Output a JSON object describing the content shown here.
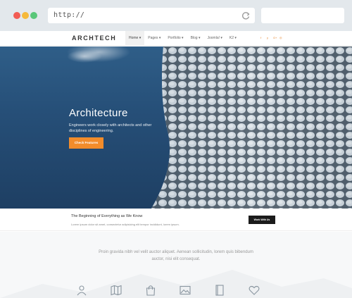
{
  "browser": {
    "url": "http://",
    "icons": {
      "reload": "reload-icon"
    },
    "colors": {
      "close": "#f25c54",
      "minimize": "#f6b93b",
      "maximize": "#59c779"
    }
  },
  "site": {
    "logo": "ARCHTECH",
    "menu": [
      {
        "label": "Home ▾"
      },
      {
        "label": "Pages ▾"
      },
      {
        "label": "Portfolio ▾"
      },
      {
        "label": "Blog ▾"
      },
      {
        "label": "Joomla! ▾"
      },
      {
        "label": "K2 ▾"
      }
    ],
    "social": [
      "f",
      "y",
      "G+",
      "◎"
    ],
    "accent": "#f28c2b"
  },
  "hero": {
    "title": "Architecture",
    "subtitle": "Engineers work closely with architects and other disciplines of engineering.",
    "button": "Check Features"
  },
  "infobar": {
    "title": "The Beginning of Everything as We Know",
    "text": "Lorem ipsum dolor sit amet, consectetur adipisicing elit tempor incididunt, lorem ipsum.",
    "button": "Work With Us"
  },
  "lower": {
    "text": "Proin gravida nibh vel velit auctor aliquet. Aenean sollicitudin, lorem quis bibendum auctor, nisi elit consequat.",
    "icons": [
      "user-icon",
      "map-icon",
      "shopping-bag-icon",
      "image-icon",
      "book-icon",
      "heart-icon"
    ]
  }
}
